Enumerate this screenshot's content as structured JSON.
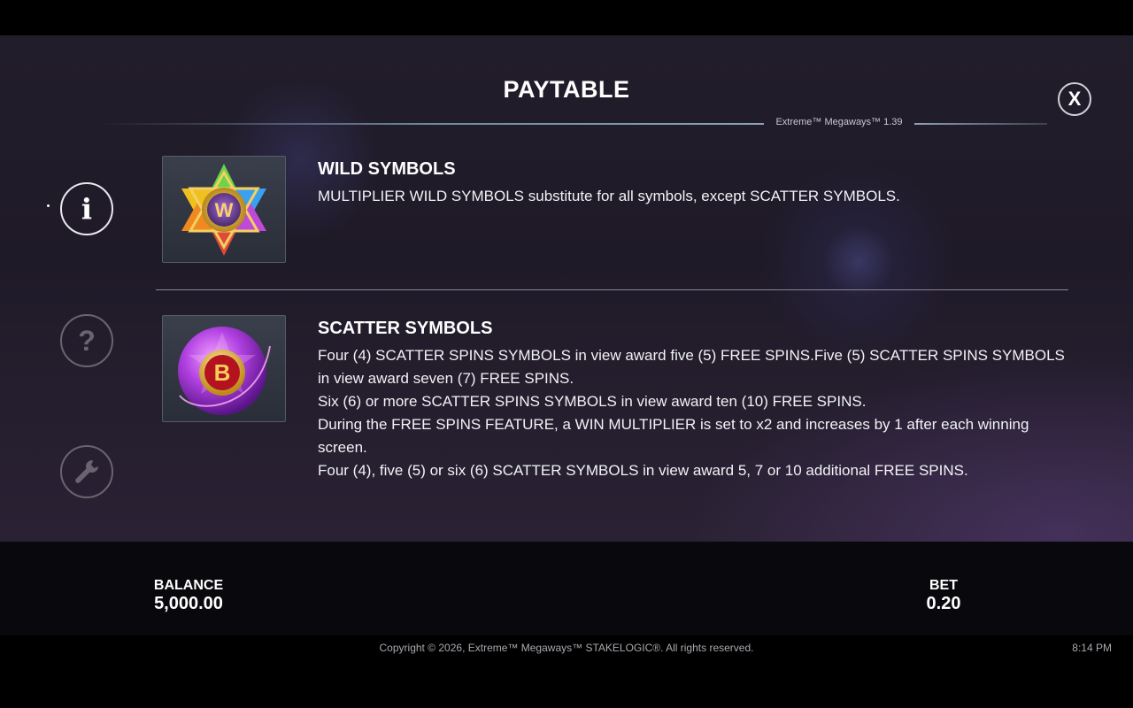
{
  "header": {
    "title": "PAYTABLE",
    "version": "Extreme™ Megaways™ 1.39",
    "close_label": "X"
  },
  "sidebar": {
    "info_label": "i",
    "help_label": "?"
  },
  "sections": {
    "wild": {
      "title": "WILD SYMBOLS",
      "text": "MULTIPLIER WILD SYMBOLS substitute for all symbols, except SCATTER SYMBOLS.",
      "symbol_letter": "W"
    },
    "scatter": {
      "title": "SCATTER SYMBOLS",
      "symbol_letter": "B",
      "lines": [
        "Four (4) SCATTER SPINS SYMBOLS in view award five (5) FREE SPINS.Five (5) SCATTER SPINS SYMBOLS in view award seven (7) FREE SPINS.",
        "Six (6) or more SCATTER SPINS SYMBOLS in view award ten (10) FREE SPINS.",
        "During the FREE SPINS FEATURE, a WIN MULTIPLIER is set to x2 and increases by 1 after each winning screen.",
        "Four (4), five (5) or six (6) SCATTER SYMBOLS in view award 5, 7 or 10 additional FREE SPINS."
      ]
    }
  },
  "bottom": {
    "balance_label": "BALANCE",
    "balance_value": "5,000.00",
    "bet_label": "BET",
    "bet_value": "0.20"
  },
  "footer": {
    "copyright": "Copyright © 2026, Extreme™ Megaways™ STAKELOGIC®. All rights reserved.",
    "time": "8:14 PM"
  }
}
